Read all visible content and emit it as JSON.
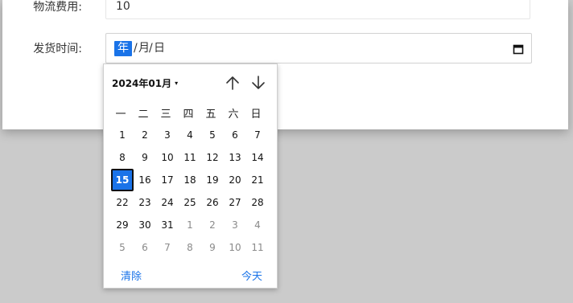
{
  "form": {
    "cost_label": "物流费用:",
    "cost_value": "10",
    "ship_label": "发货时间:",
    "date_segments": {
      "year": "年",
      "sep": "/",
      "month": "月",
      "day": "日"
    }
  },
  "picker": {
    "month_label": "2024年01月",
    "caret": "▾",
    "weekdays": [
      "一",
      "二",
      "三",
      "四",
      "五",
      "六",
      "日"
    ],
    "weeks": [
      [
        {
          "d": "1",
          "cur": true
        },
        {
          "d": "2",
          "cur": true
        },
        {
          "d": "3",
          "cur": true
        },
        {
          "d": "4",
          "cur": true
        },
        {
          "d": "5",
          "cur": true
        },
        {
          "d": "6",
          "cur": true
        },
        {
          "d": "7",
          "cur": true
        }
      ],
      [
        {
          "d": "8",
          "cur": true
        },
        {
          "d": "9",
          "cur": true
        },
        {
          "d": "10",
          "cur": true
        },
        {
          "d": "11",
          "cur": true
        },
        {
          "d": "12",
          "cur": true
        },
        {
          "d": "13",
          "cur": true
        },
        {
          "d": "14",
          "cur": true
        }
      ],
      [
        {
          "d": "15",
          "cur": true,
          "sel": true
        },
        {
          "d": "16",
          "cur": true
        },
        {
          "d": "17",
          "cur": true
        },
        {
          "d": "18",
          "cur": true
        },
        {
          "d": "19",
          "cur": true
        },
        {
          "d": "20",
          "cur": true
        },
        {
          "d": "21",
          "cur": true
        }
      ],
      [
        {
          "d": "22",
          "cur": true
        },
        {
          "d": "23",
          "cur": true
        },
        {
          "d": "24",
          "cur": true
        },
        {
          "d": "25",
          "cur": true
        },
        {
          "d": "26",
          "cur": true
        },
        {
          "d": "27",
          "cur": true
        },
        {
          "d": "28",
          "cur": true
        }
      ],
      [
        {
          "d": "29",
          "cur": true
        },
        {
          "d": "30",
          "cur": true
        },
        {
          "d": "31",
          "cur": true
        },
        {
          "d": "1",
          "cur": false
        },
        {
          "d": "2",
          "cur": false
        },
        {
          "d": "3",
          "cur": false
        },
        {
          "d": "4",
          "cur": false
        }
      ],
      [
        {
          "d": "5",
          "cur": false
        },
        {
          "d": "6",
          "cur": false
        },
        {
          "d": "7",
          "cur": false
        },
        {
          "d": "8",
          "cur": false
        },
        {
          "d": "9",
          "cur": false
        },
        {
          "d": "10",
          "cur": false
        },
        {
          "d": "11",
          "cur": false
        }
      ]
    ],
    "clear_label": "清除",
    "today_label": "今天"
  },
  "icons": {
    "calendar": "calendar-icon",
    "up": "arrow-up-icon",
    "down": "arrow-down-icon"
  },
  "colors": {
    "accent": "#1a73e8",
    "backdrop": "#cbcbcb"
  }
}
